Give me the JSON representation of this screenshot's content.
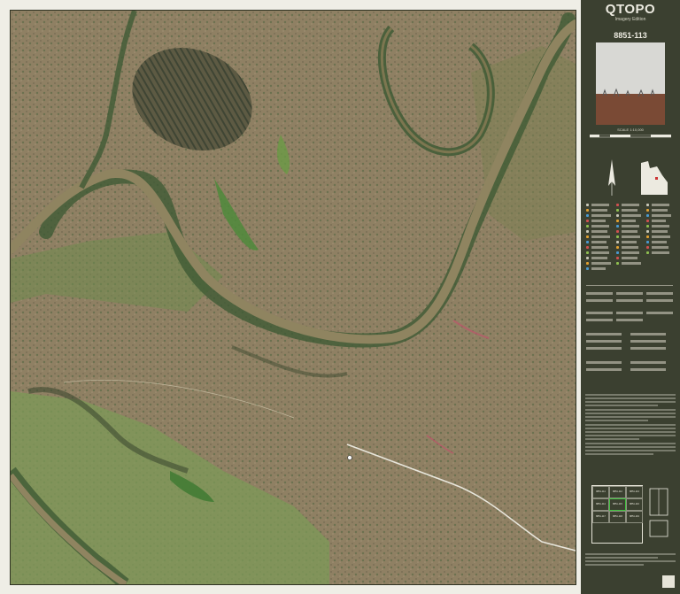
{
  "map": {
    "title": "QTOPO",
    "subtitle": "Imagery Edition",
    "sheet_number": "8851-113",
    "scale_text": "SCALE 1:10,000",
    "colors": {
      "panel_bg": "#3b4030",
      "river": "#8f8460",
      "vegetation": "#3f5a35",
      "grass": "#7b9a54",
      "bare_ground": "#9b8a6d",
      "road": "#e8e6dc",
      "water_label_bg": "#2d6fa5"
    },
    "index_sheets": [
      "8851-111",
      "8851-112",
      "8851-113",
      "8851-114",
      "8851-115",
      "8851-116",
      "8851-117",
      "8851-118",
      "8851-119"
    ],
    "current_sheet_index": 4,
    "icons": [
      "cover-photo",
      "north-arrow-icon",
      "queensland-locator-icon",
      "index-map",
      "logo-icon"
    ]
  }
}
